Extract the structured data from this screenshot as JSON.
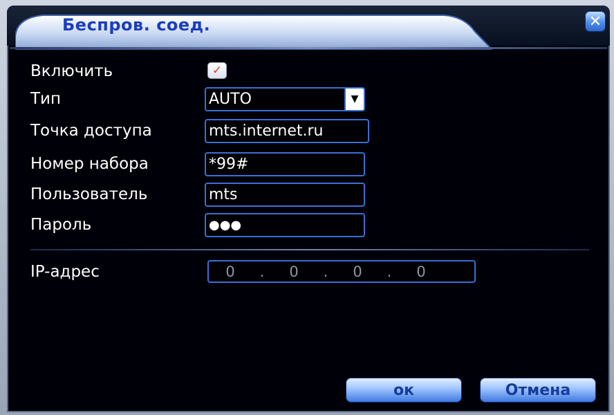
{
  "window": {
    "title": "Беспров. соед.",
    "close_icon": "close-icon"
  },
  "form": {
    "enable_label": "Включить",
    "enable_checked": true,
    "type_label": "Тип",
    "type_value": "AUTO",
    "ap_label": "Точка доступа",
    "ap_value": "mts.internet.ru",
    "dial_label": "Номер набора",
    "dial_value": "*99#",
    "user_label": "Пользователь",
    "user_value": "mts",
    "password_label": "Пароль",
    "password_value": "●●●",
    "ip_label": "IP-адрес",
    "ip_octets": [
      "0",
      "0",
      "0",
      "0"
    ]
  },
  "buttons": {
    "ok_label": "ок",
    "cancel_label": "Отмена"
  },
  "colors": {
    "accent": "#3a6fd6",
    "title_text": "#1c3dbd",
    "background": "#000008"
  }
}
